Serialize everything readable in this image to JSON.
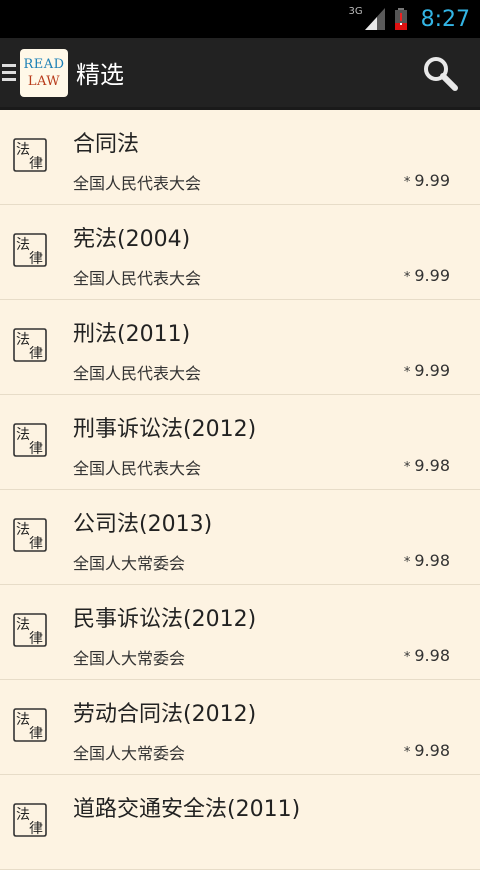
{
  "status_bar": {
    "network": "3G",
    "time": "8:27"
  },
  "action_bar": {
    "logo_line1": "READ",
    "logo_line2": "LAW",
    "title": "精选"
  },
  "list_icon_chars": [
    "法",
    "律"
  ],
  "items": [
    {
      "title": "合同法",
      "publisher": "全国人民代表大会",
      "price": "9.99"
    },
    {
      "title": "宪法(2004)",
      "publisher": "全国人民代表大会",
      "price": "9.99"
    },
    {
      "title": "刑法(2011)",
      "publisher": "全国人民代表大会",
      "price": "9.99"
    },
    {
      "title": "刑事诉讼法(2012)",
      "publisher": "全国人民代表大会",
      "price": "9.98"
    },
    {
      "title": "公司法(2013)",
      "publisher": "全国人大常委会",
      "price": "9.98"
    },
    {
      "title": "民事诉讼法(2012)",
      "publisher": "全国人大常委会",
      "price": "9.98"
    },
    {
      "title": "劳动合同法(2012)",
      "publisher": "全国人大常委会",
      "price": "9.98"
    },
    {
      "title": "道路交通安全法(2011)",
      "publisher": "",
      "price": ""
    }
  ],
  "colors": {
    "accent": "#33b5e5",
    "background": "#fdf3e2",
    "action_bar": "#222222"
  }
}
